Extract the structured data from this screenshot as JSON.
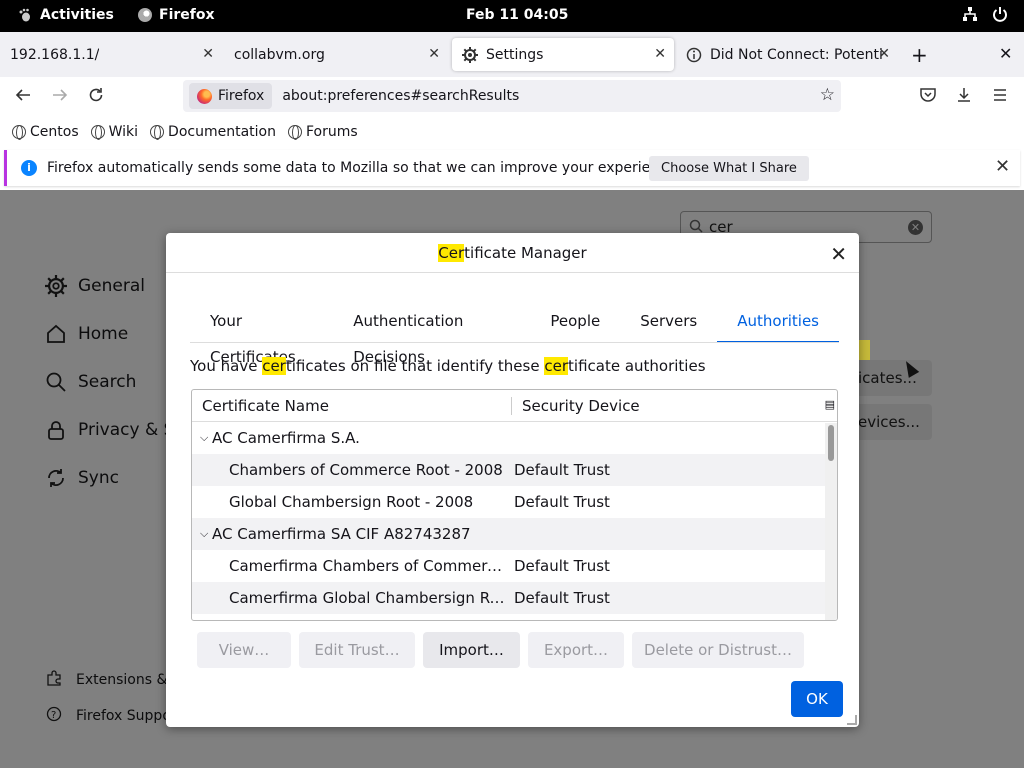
{
  "topbar": {
    "activities": "Activities",
    "app": "Firefox",
    "clock": "Feb 11  04:05"
  },
  "tabs": [
    {
      "title": "192.168.1.1/"
    },
    {
      "title": "collabvm.org"
    },
    {
      "title": "Settings"
    },
    {
      "title": "Did Not Connect: Potentia"
    }
  ],
  "navbar": {
    "identity": "Firefox",
    "url": "about:preferences#searchResults"
  },
  "bookmarks": [
    "Centos",
    "Wiki",
    "Documentation",
    "Forums"
  ],
  "notification": {
    "message": "Firefox automatically sends some data to Mozilla so that we can improve your experience.",
    "button": "Choose What I Share"
  },
  "settings": {
    "search_value": "cer",
    "sidebar": [
      "General",
      "Home",
      "Search",
      "Privacy & Se",
      "Sync"
    ],
    "footer": [
      "Extensions & T",
      "Firefox Suppo"
    ],
    "bg_buttons": [
      "icates...",
      "evices..."
    ]
  },
  "dialog": {
    "title_hl": "Cer",
    "title_rest": "tificate Manager",
    "tabs": [
      "Your Certificates",
      "Authentication Decisions",
      "People",
      "Servers",
      "Authorities"
    ],
    "selected_tab": "Authorities",
    "desc": {
      "p1": "You have ",
      "h1": "cer",
      "p2": "tificates on file that identify these ",
      "h2": "cer",
      "p3": "tificate authorities"
    },
    "columns": {
      "name": "Certificate Name",
      "device": "Security Device"
    },
    "rows": [
      {
        "name": "AC Camerfirma S.A.",
        "device": "",
        "group": true
      },
      {
        "name": "Chambers of Commerce Root - 2008",
        "device": "Default Trust",
        "group": false
      },
      {
        "name": "Global Chambersign Root - 2008",
        "device": "Default Trust",
        "group": false
      },
      {
        "name": "AC Camerfirma SA CIF A82743287",
        "device": "",
        "group": true
      },
      {
        "name": "Camerfirma Chambers of Commerce R...",
        "device": "Default Trust",
        "group": false
      },
      {
        "name": "Camerfirma Global Chambersign Root",
        "device": "Default Trust",
        "group": false
      }
    ],
    "buttons": {
      "view": "View…",
      "edit": "Edit Trust…",
      "import": "Import…",
      "export": "Export…",
      "delete": "Delete or Distrust…",
      "ok": "OK"
    }
  }
}
